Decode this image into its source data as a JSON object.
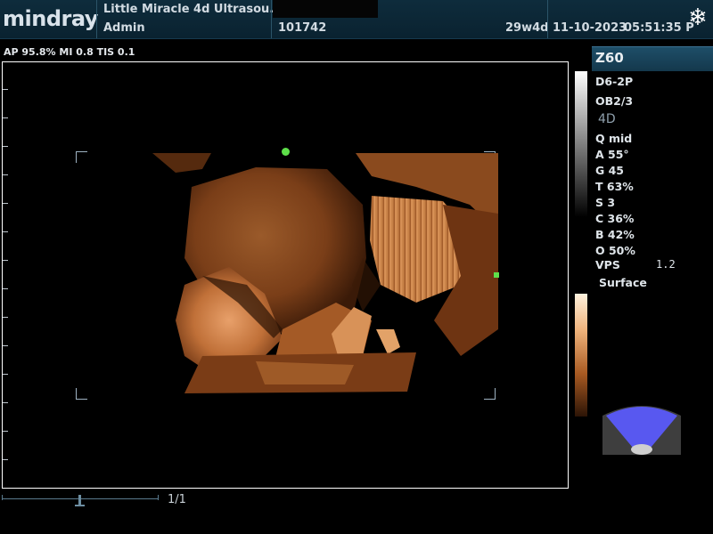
{
  "header": {
    "logo": "mindray",
    "institution": "Little Miracle 4d Ultrasou...",
    "operator": "Admin",
    "patient_id": "101742",
    "gestational_age": "29w4d",
    "date": "11-10-2023",
    "time": "05:51:35 P",
    "freeze_icon": "snowflake-icon"
  },
  "acoustic": {
    "text": "AP 95.8%  MI 0.8 TIS 0.1"
  },
  "right_panel": {
    "probe": "Z60",
    "params": [
      "D6-2P",
      "OB2/3",
      "4D",
      "Q mid",
      "A 55°",
      "G 45",
      "T 63%",
      "S 3",
      "C 36%",
      "B 42%",
      "O 50%",
      "VPS",
      "Surface"
    ],
    "vps_value": "1.2"
  },
  "cine": {
    "frame_count": "1/1"
  },
  "colors": {
    "header_bg": "#0e2c3c",
    "accent": "#1e4e68",
    "marker_green": "#5ee04a",
    "fan_blue": "#5858f0"
  }
}
